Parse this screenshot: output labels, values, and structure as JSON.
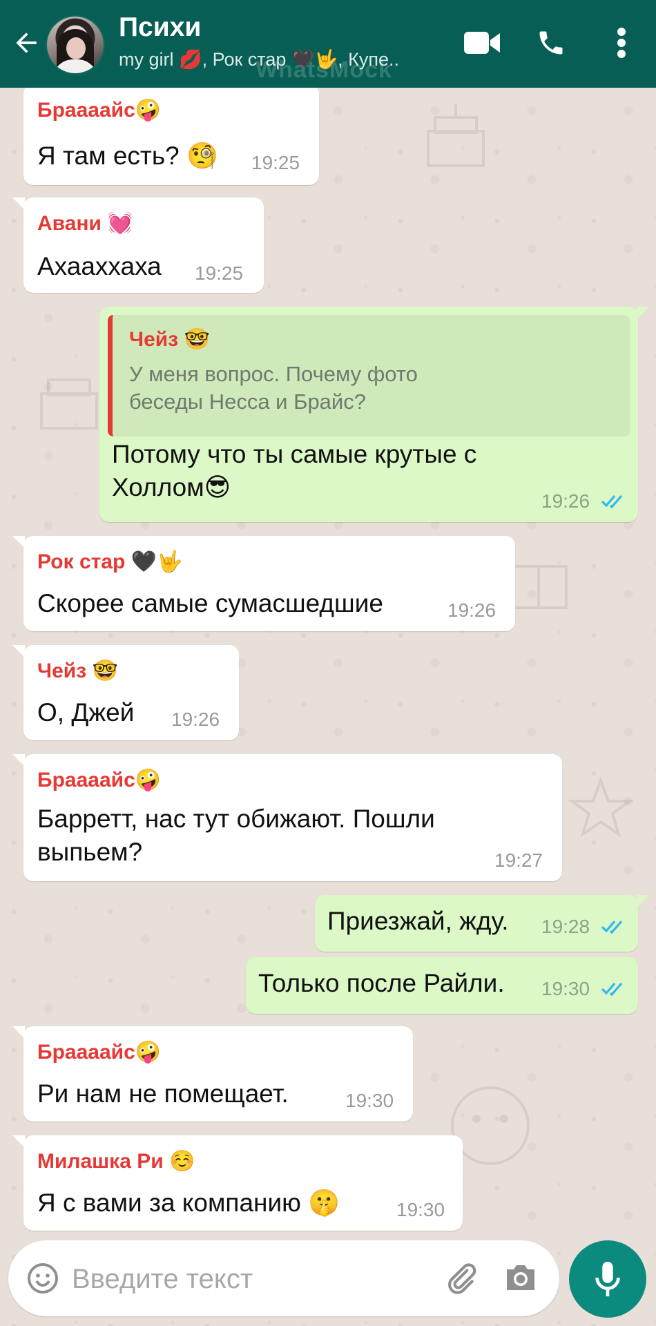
{
  "header": {
    "title": "Психи",
    "subtitle": "my girl 💋, Рок стар 🖤🤟, Купе..",
    "watermark": "WhatsMock"
  },
  "messages": [
    {
      "sender": "Браааайс🤪",
      "sender_color": "#E53935",
      "text": "Я там есть? 🧐",
      "time": "19:25",
      "direction": "in"
    },
    {
      "sender": "Авани 💓",
      "sender_color": "#E53935",
      "text": "Ахааххаха",
      "time": "19:25",
      "direction": "in"
    },
    {
      "quote_sender": "Чейз 🤓",
      "quote_text_1": "У меня вопрос. Почему фото",
      "quote_text_2": "беседы Несса и Брайс?",
      "text_1": "Потому что ты самые крутые с",
      "text_2": "Холлом😎",
      "time": "19:26",
      "direction": "out",
      "read": true
    },
    {
      "sender": "Рок стар 🖤🤟",
      "sender_color": "#E53935",
      "text": "Скорее самые сумасшедшие",
      "time": "19:26",
      "direction": "in"
    },
    {
      "sender": "Чейз 🤓",
      "sender_color": "#E53935",
      "text": "О, Джей",
      "time": "19:26",
      "direction": "in"
    },
    {
      "sender": "Браааайс🤪",
      "sender_color": "#E53935",
      "text_1": "Барретт, нас тут обижают. Пошли",
      "text_2": "выпьем?",
      "time": "19:27",
      "direction": "in"
    },
    {
      "text": "Приезжай, жду.",
      "time": "19:28",
      "direction": "out",
      "read": true
    },
    {
      "text": "Только после Райли.",
      "time": "19:30",
      "direction": "out",
      "read": true
    },
    {
      "sender": "Браааайс🤪",
      "sender_color": "#E53935",
      "text": "Ри нам не помещает.",
      "time": "19:30",
      "direction": "in"
    },
    {
      "sender": "Милашка Ри ☺️",
      "sender_color": "#E53935",
      "text": "Я с вами за компанию 🤫",
      "time": "19:30",
      "direction": "in"
    }
  ],
  "composer": {
    "placeholder": "Введите текст"
  },
  "colors": {
    "header_bg": "#075E54",
    "incoming_bg": "#FFFFFF",
    "outgoing_bg": "#DCF8C6",
    "sender_name": "#E53935",
    "read_ticks": "#34B7F1",
    "mic_button": "#0B8A7E"
  },
  "icons": {
    "back": "arrow-left-icon",
    "video": "video-camera-icon",
    "call": "phone-icon",
    "menu": "more-vertical-icon",
    "emoji": "smiley-icon",
    "attach": "paperclip-icon",
    "camera": "camera-icon",
    "mic": "microphone-icon"
  }
}
